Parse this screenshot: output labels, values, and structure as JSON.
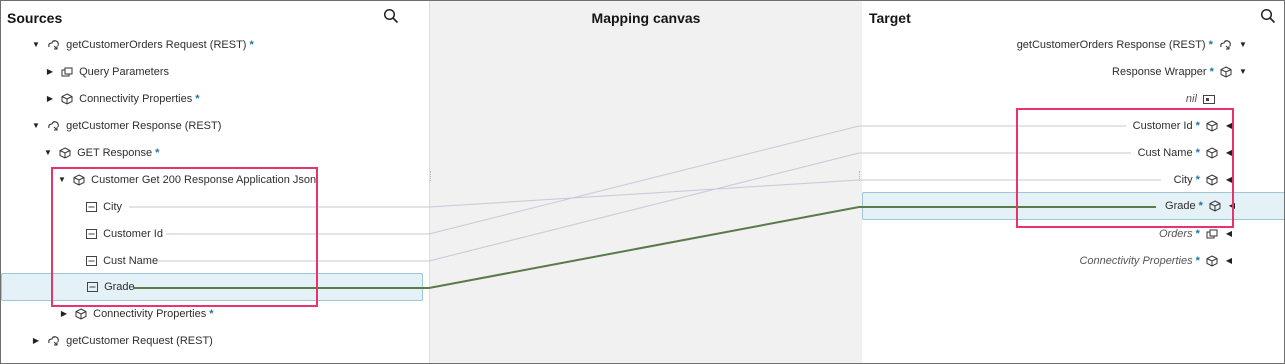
{
  "sources": {
    "title": "Sources",
    "rows": [
      {
        "label": "getCustomerOrders Request (REST)",
        "required": "*",
        "arrow": "▼",
        "icon": "rest-icon"
      },
      {
        "label": "Query Parameters",
        "required": "",
        "arrow": "▶",
        "icon": "group-icon"
      },
      {
        "label": "Connectivity Properties",
        "required": "*",
        "arrow": "▶",
        "icon": "object-icon"
      },
      {
        "label": "getCustomer Response (REST)",
        "required": "",
        "arrow": "▼",
        "icon": "rest-icon"
      },
      {
        "label": "GET Response",
        "required": "*",
        "arrow": "▼",
        "icon": "object-icon"
      },
      {
        "label": "Customer Get 200 Response Application Json",
        "required": "",
        "arrow": "▼",
        "icon": "object-icon"
      },
      {
        "label": "City",
        "required": "",
        "arrow": "",
        "icon": "field-icon"
      },
      {
        "label": "Customer Id",
        "required": "",
        "arrow": "",
        "icon": "field-icon"
      },
      {
        "label": "Cust Name",
        "required": "",
        "arrow": "",
        "icon": "field-icon"
      },
      {
        "label": "Grade",
        "required": "",
        "arrow": "",
        "icon": "field-icon"
      },
      {
        "label": "Connectivity Properties",
        "required": "*",
        "arrow": "▶",
        "icon": "object-icon"
      },
      {
        "label": "getCustomer Request (REST)",
        "required": "",
        "arrow": "▶",
        "icon": "rest-icon"
      }
    ]
  },
  "canvas": {
    "title": "Mapping canvas"
  },
  "target": {
    "title": "Target",
    "rows": [
      {
        "label": "getCustomerOrders Response (REST)",
        "required": "*",
        "arrow": "▼",
        "icon": "rest-icon"
      },
      {
        "label": "Response Wrapper",
        "required": "*",
        "arrow": "▼",
        "icon": "object-icon"
      },
      {
        "label": "nil",
        "required": "",
        "arrow": "",
        "icon": "nil-icon"
      },
      {
        "label": "Customer Id",
        "required": "*",
        "arrow": "◀",
        "icon": "object-icon"
      },
      {
        "label": "Cust Name",
        "required": "*",
        "arrow": "◀",
        "icon": "object-icon"
      },
      {
        "label": "City",
        "required": "*",
        "arrow": "◀",
        "icon": "object-icon"
      },
      {
        "label": "Grade",
        "required": "*",
        "arrow": "◀",
        "icon": "object-icon"
      },
      {
        "label": "Orders",
        "required": "*",
        "arrow": "◀",
        "icon": "group-icon"
      },
      {
        "label": "Connectivity Properties",
        "required": "*",
        "arrow": "◀",
        "icon": "object-icon"
      }
    ]
  },
  "colors": {
    "accent": "#1f74a8",
    "highlight": "#e8336b",
    "active_wire": "#5a7a4a",
    "wire": "#c5c8d8",
    "selection": "#e4f1f7"
  }
}
